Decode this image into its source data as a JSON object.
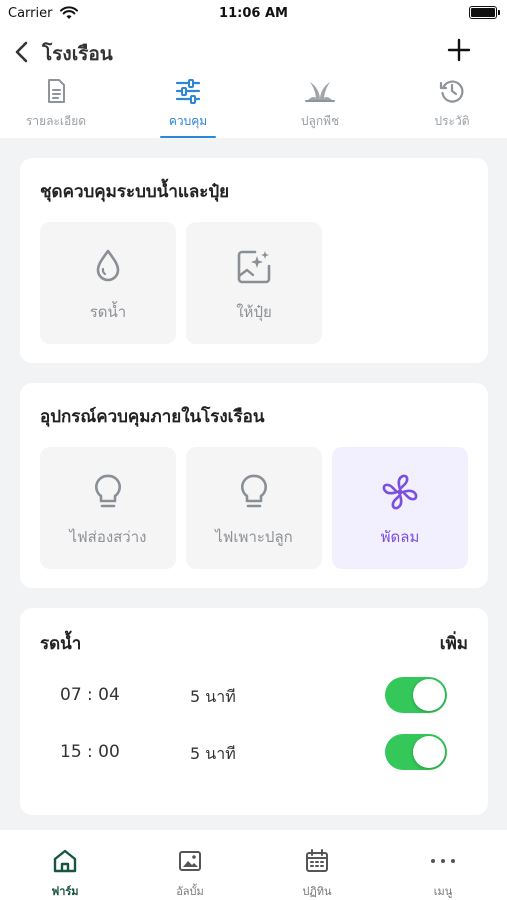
{
  "status_bar": {
    "carrier": "Carrier",
    "time": "11:06 AM"
  },
  "nav": {
    "title": "โรงเรือน"
  },
  "tabs": [
    {
      "label": "รายละเอียด",
      "icon": "document-icon"
    },
    {
      "label": "ควบคุม",
      "icon": "sliders-icon",
      "active": true
    },
    {
      "label": "ปลูกพืช",
      "icon": "plant-icon"
    },
    {
      "label": "ประวัติ",
      "icon": "history-icon"
    }
  ],
  "water_fert_card": {
    "title": "ชุดควบคุมระบบน้ำและปุ๋ย",
    "items": [
      {
        "label": "รดน้ำ",
        "icon": "water-drop-icon"
      },
      {
        "label": "ให้ปุ๋ย",
        "icon": "fertilizer-sparkle-icon"
      }
    ]
  },
  "devices_card": {
    "title": "อุปกรณ์ควบคุมภายในโรงเรือน",
    "items": [
      {
        "label": "ไฟส่องสว่าง",
        "icon": "light-bulb-icon"
      },
      {
        "label": "ไฟเพาะปลูก",
        "icon": "light-bulb-icon"
      },
      {
        "label": "พัดลม",
        "icon": "fan-icon",
        "active": true
      }
    ]
  },
  "watering_card": {
    "title": "รดน้ำ",
    "add_label": "เพิ่ม",
    "schedules": [
      {
        "time": "07 : 04",
        "duration": "5 นาที",
        "enabled": true
      },
      {
        "time": "15 : 00",
        "duration": "5 นาที",
        "enabled": true
      }
    ]
  },
  "bottom_tabs": [
    {
      "label": "ฟาร์ม",
      "icon": "home-icon",
      "active": true
    },
    {
      "label": "อัลบั้ม",
      "icon": "image-icon"
    },
    {
      "label": "ปฏิทิน",
      "icon": "calendar-icon"
    },
    {
      "label": "เมนู",
      "icon": "more-icon"
    }
  ],
  "colors": {
    "accent_blue": "#2e86d6",
    "accent_purple": "#7b4fe0",
    "toggle_green": "#34c759",
    "brand_green": "#17553f",
    "background": "#f2f3f5"
  }
}
